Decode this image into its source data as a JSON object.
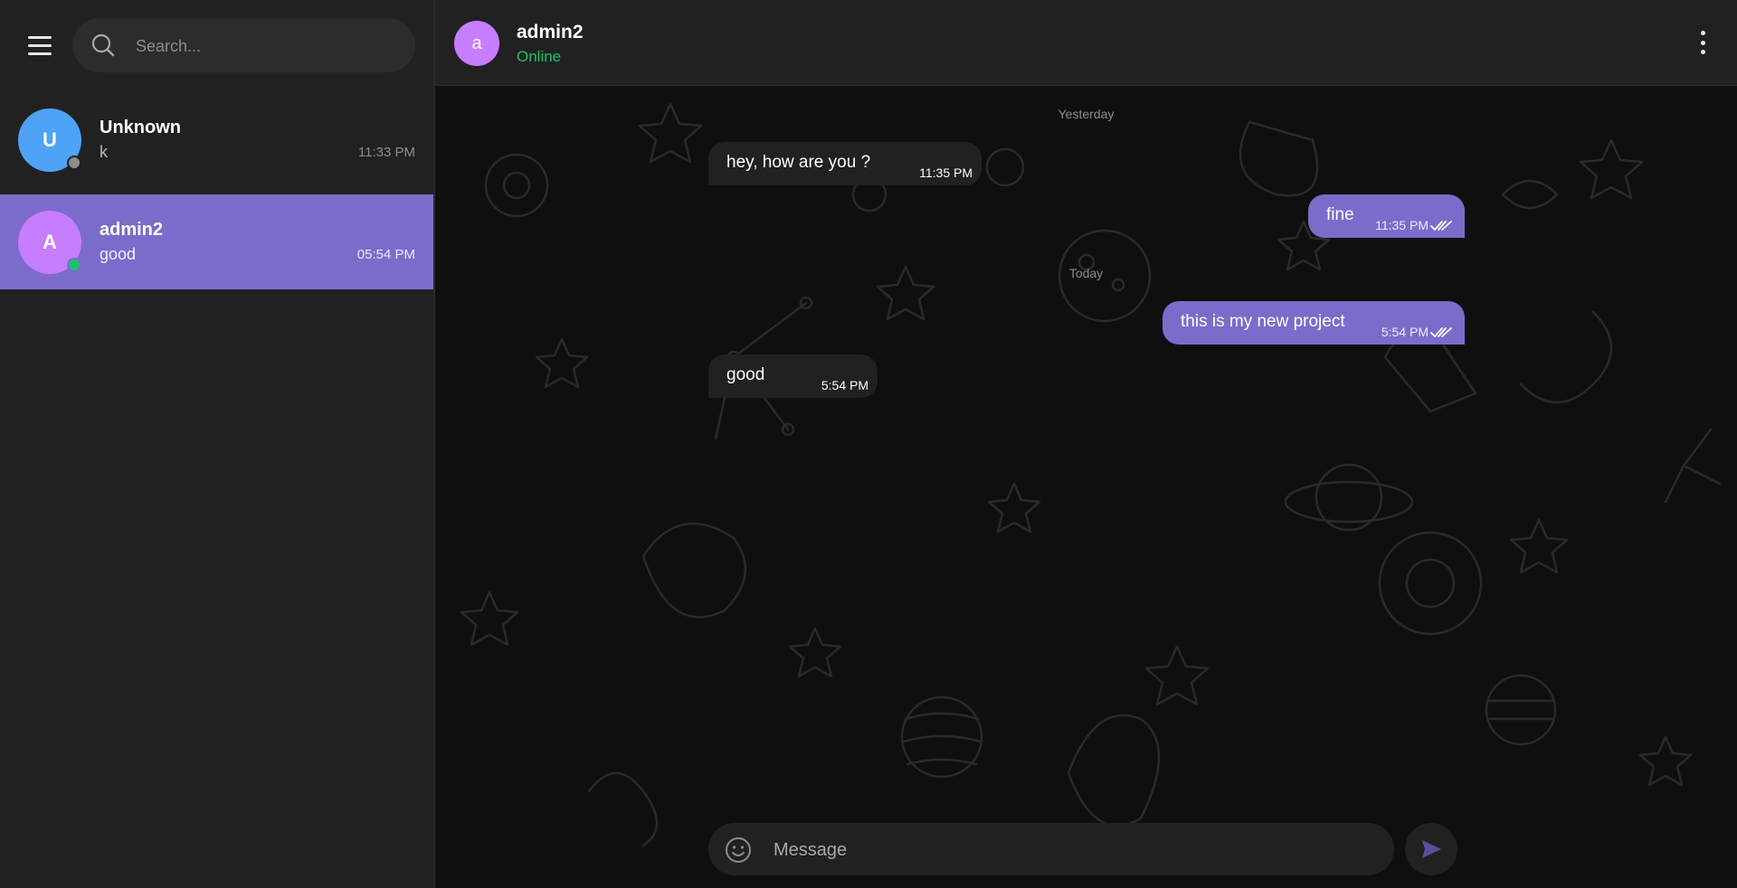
{
  "sidebar": {
    "search": {
      "placeholder": "Search..."
    },
    "chats": [
      {
        "initial": "U",
        "name": "Unknown",
        "preview": "k",
        "time": "11:33 PM",
        "avatar_color": "#4fa3f7",
        "status_color": "#8d8d8d",
        "active": false
      },
      {
        "initial": "A",
        "name": "admin2",
        "preview": "good",
        "time": "05:54 PM",
        "avatar_color": "#c77dff",
        "status_color": "#1dc36b",
        "active": true
      }
    ]
  },
  "header": {
    "avatar_initial": "a",
    "title": "admin2",
    "status": "Online"
  },
  "messages": {
    "date_yesterday": "Yesterday",
    "date_today": "Today",
    "items": [
      {
        "direction": "in",
        "text": "hey, how are you ?",
        "time": "11:35 PM"
      },
      {
        "direction": "out",
        "text": "fine",
        "time": "11:35 PM",
        "read": true
      },
      {
        "direction": "out",
        "text": "this is my new project",
        "time": "5:54 PM",
        "read": true
      },
      {
        "direction": "in",
        "text": "good",
        "time": "5:54 PM"
      }
    ]
  },
  "composer": {
    "placeholder": "Message"
  },
  "colors": {
    "accent": "#7b6ccb",
    "online": "#1dc36b",
    "panel": "#212121",
    "background": "#0f0f0f"
  },
  "icons": [
    "menu-icon",
    "search-icon",
    "more-vertical-icon",
    "double-check-icon",
    "emoji-icon",
    "send-icon"
  ]
}
